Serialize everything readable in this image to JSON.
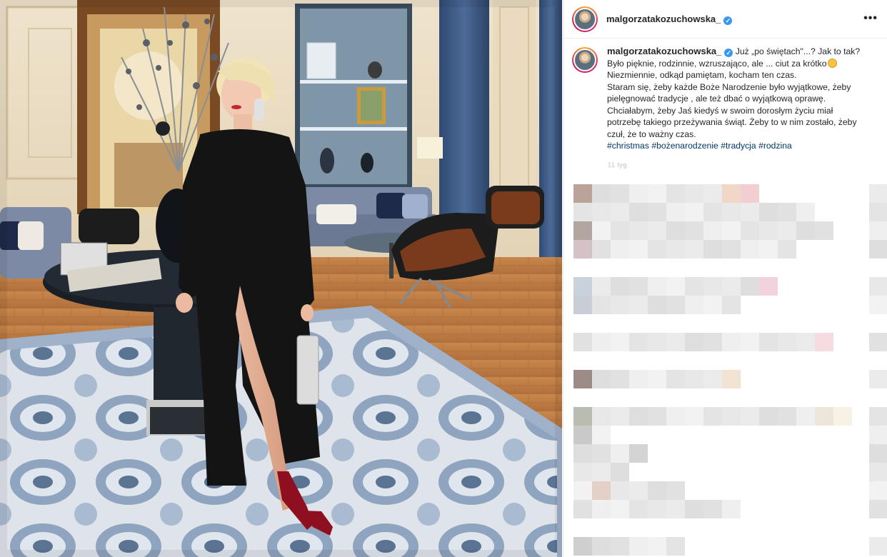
{
  "post": {
    "username": "malgorzatakozuchowska_",
    "verified_mark": "✓",
    "more_menu": "•••",
    "caption": {
      "lines": [
        "Już „po świętach\"...? Jak to tak?",
        "Było pięknie, rodzinnie, wzruszająco, ale ... ciut za krótko",
        "Niezmiennie, odkąd pamiętam, kocham ten czas.",
        "Staram się, żeby każde Boże Narodzenie było wyjątkowe, żeby",
        "pielęgnować tradycje , ale też dbać o wyjątkową oprawę.",
        "Chciałabym, żeby Jaś kiedyś w swoim dorosłym życiu miał",
        "potrzebę takiego przeżywania świąt. Żeby to w nim zostało, żeby",
        "czuł, że to ważny czas."
      ],
      "hashtags": [
        "#christmas",
        "#bożenarodzenie",
        "#tradycja",
        "#rodzina"
      ]
    },
    "time_ago": "11 tyg."
  },
  "colors": {
    "link": "#00376b",
    "verified": "#3897f0",
    "dress": "#141414",
    "shoes": "#8e1020",
    "rug": "#9bb0c8",
    "floor": "#c98a52"
  }
}
